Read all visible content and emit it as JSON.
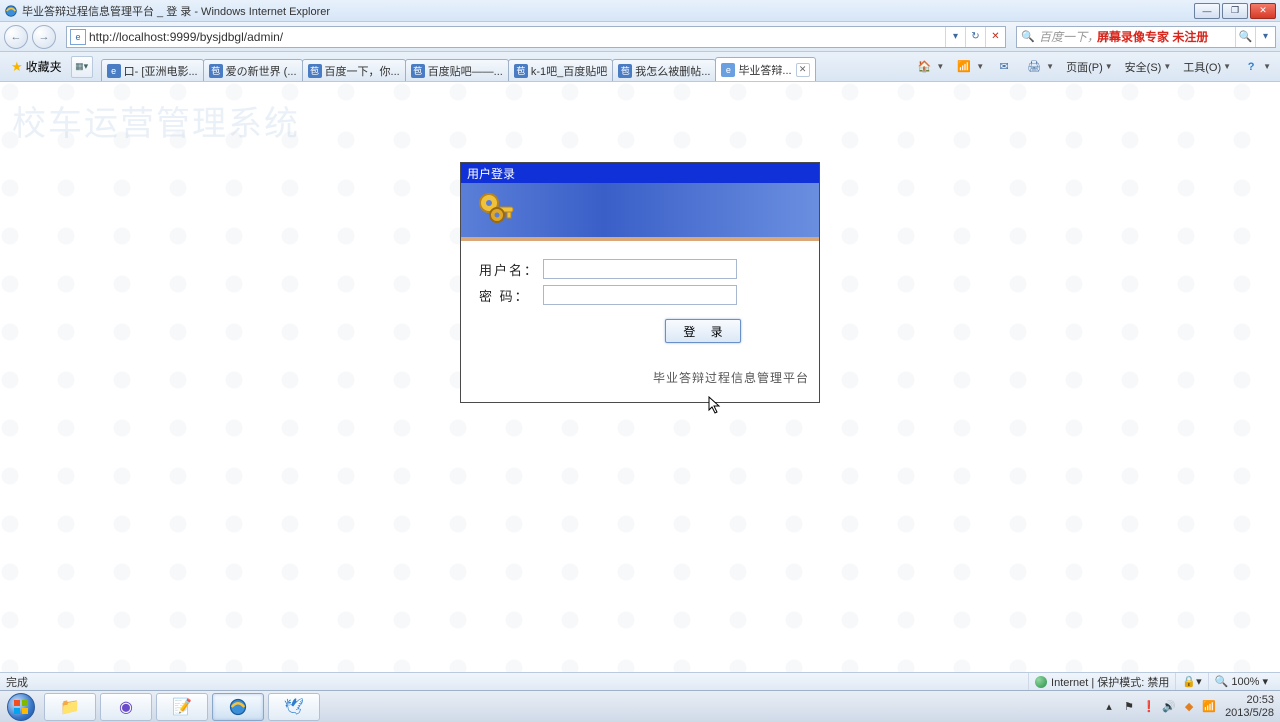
{
  "window": {
    "title": "毕业答辩过程信息管理平台 _ 登 录 - Windows Internet Explorer",
    "url": "http://localhost:9999/bysjdbgl/admin/"
  },
  "search": {
    "placeholder": "百度一下，你",
    "overlay": "屏幕录像专家  未注册"
  },
  "favorites_label": "收藏夹",
  "tabs": [
    {
      "label": "口- [亚洲电影..."
    },
    {
      "label": "爱の新世界 (..."
    },
    {
      "label": "百度一下，你..."
    },
    {
      "label": "百度贴吧——..."
    },
    {
      "label": "k-1吧_百度贴吧"
    },
    {
      "label": "我怎么被删帖..."
    },
    {
      "label": "毕业答辩..."
    }
  ],
  "toolbar": {
    "page": "页面(P)",
    "safety": "安全(S)",
    "tools": "工具(O)"
  },
  "ghost_title": "校车运营管理系统",
  "login": {
    "title": "用户登录",
    "username_label": "用户名：",
    "password_label": "密  码：",
    "username_value": "",
    "password_value": "",
    "button": "登 录",
    "footer": "毕业答辩过程信息管理平台"
  },
  "status": {
    "left": "完成",
    "zone": "Internet | 保护模式: 禁用",
    "zoom": "100%"
  },
  "tray": {
    "time": "20:53",
    "date": "2013/5/28"
  }
}
